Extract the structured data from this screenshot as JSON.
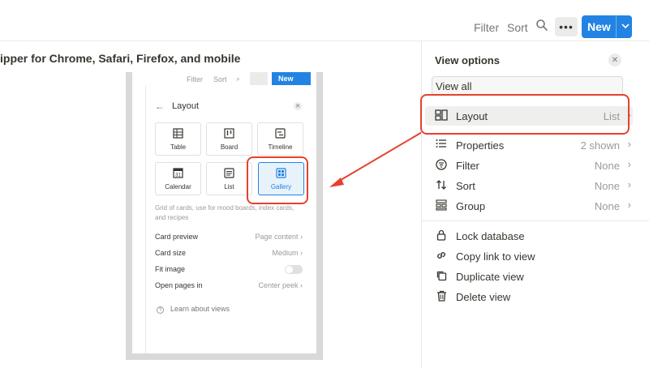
{
  "topbar": {
    "filter_label": "Filter",
    "sort_label": "Sort",
    "more_label": "•••",
    "new_label": "New",
    "new_dropdown": "⌄"
  },
  "caption": "ipper for Chrome, Safari, Firefox, and mobile",
  "screenshot": {
    "toolbar": {
      "filter": "Filter",
      "sort": "Sort",
      "new": "New"
    },
    "title": "Layout",
    "layouts": [
      {
        "label": "Table",
        "icon": "⊞"
      },
      {
        "label": "Board",
        "icon": "☷"
      },
      {
        "label": "Timeline",
        "icon": "☰"
      },
      {
        "label": "Calendar",
        "icon": "31"
      },
      {
        "label": "List",
        "icon": "≡"
      },
      {
        "label": "Gallery",
        "icon": "⊞"
      }
    ],
    "description": "Grid of cards, use for mood boards, index cards, and recipes",
    "settings": [
      {
        "key": "Card preview",
        "value": "Page content ›"
      },
      {
        "key": "Card size",
        "value": "Medium ›"
      },
      {
        "key": "Fit image",
        "value": ""
      },
      {
        "key": "Open pages in",
        "value": "Center peek ›"
      }
    ],
    "learn": "Learn about views"
  },
  "panel": {
    "title": "View options",
    "view_name": "View all",
    "items": [
      {
        "label": "Layout",
        "value": "List",
        "icon": "layout-icon"
      },
      {
        "label": "Properties",
        "value": "2 shown",
        "icon": "properties-icon"
      },
      {
        "label": "Filter",
        "value": "None",
        "icon": "filter-icon"
      },
      {
        "label": "Sort",
        "value": "None",
        "icon": "sort-icon"
      },
      {
        "label": "Group",
        "value": "None",
        "icon": "group-icon"
      }
    ],
    "actions": [
      {
        "label": "Lock database",
        "icon": "lock-icon"
      },
      {
        "label": "Copy link to view",
        "icon": "link-icon"
      },
      {
        "label": "Duplicate view",
        "icon": "duplicate-icon"
      },
      {
        "label": "Delete view",
        "icon": "trash-icon"
      }
    ]
  },
  "colors": {
    "accent": "#2383e2",
    "highlight_outline": "#e5412f"
  }
}
